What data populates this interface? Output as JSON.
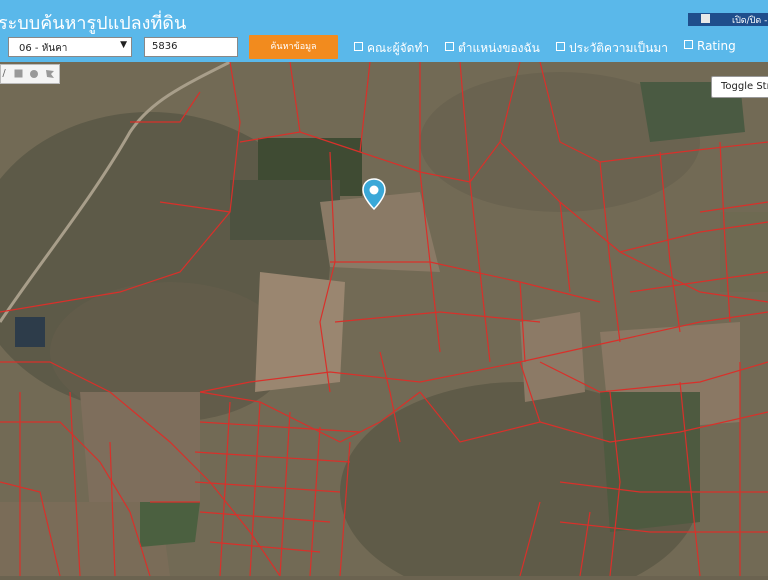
{
  "header": {
    "title": "ระบบค้นหารูปแปลงที่ดิน",
    "toggle_label": "เปิด/ปิด - U"
  },
  "search": {
    "district_selected": "06 - หันคา",
    "parcel_number": "5836",
    "search_button": "ค้นหาข้อมูล"
  },
  "nav": {
    "team": "คณะผู้จัดทำ",
    "my_location": "ตำแหน่งของฉัน",
    "history": "ประวัติความเป็นมา",
    "rating": "Rating"
  },
  "map": {
    "toggle_street_label": "Toggle Street",
    "draw_tools": [
      "line-tool-icon",
      "rectangle-tool-icon",
      "circle-tool-icon",
      "polygon-tool-icon"
    ],
    "parcel_line_color": "#d9302a",
    "marker_color": "#3aa8d8"
  }
}
